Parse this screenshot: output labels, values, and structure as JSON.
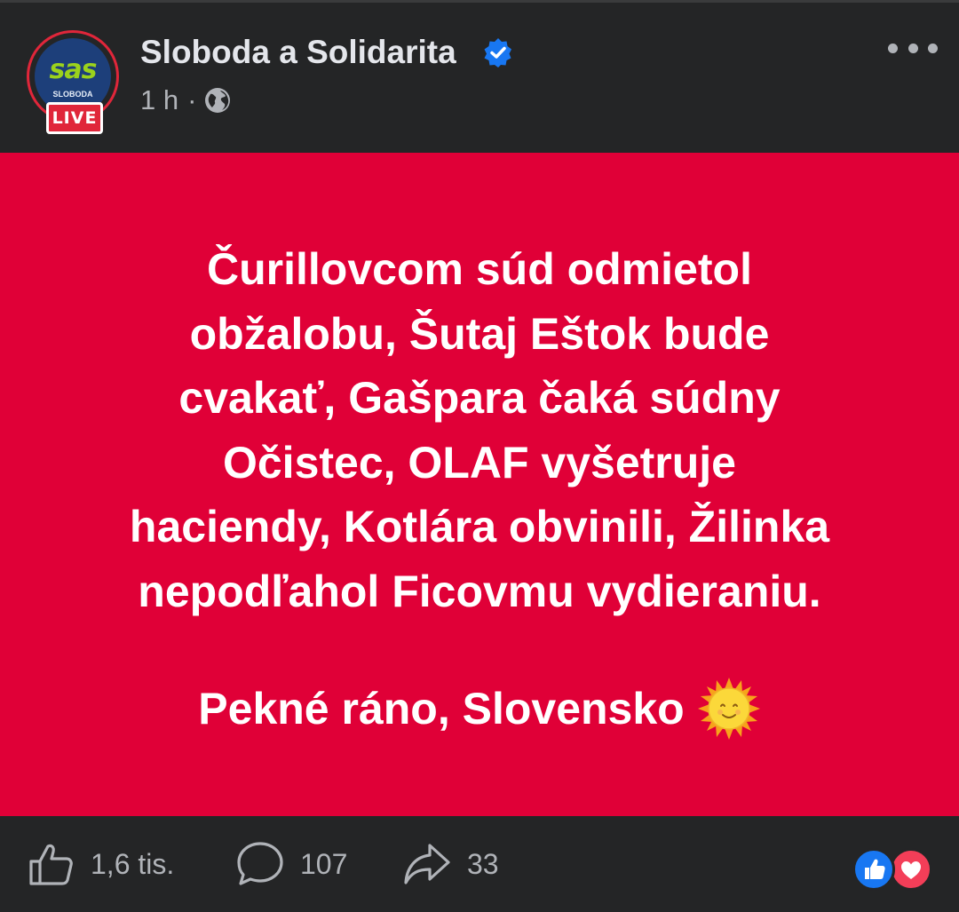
{
  "post": {
    "author": "Sloboda a Solidarita",
    "verified": true,
    "time": "1 h",
    "separator": "·",
    "audience_icon": "globe-icon",
    "avatar": {
      "logo_text": "sas",
      "logo_sub": "SLOBODA",
      "live_badge": "LIVE",
      "ring_color": "#e0263a",
      "logo_color": "#9bd21c"
    },
    "more_icon": "more-options-icon",
    "card": {
      "background": "#e00037",
      "headline_lines": [
        "Čurillovcom súd odmietol",
        "obžalobu, Šutaj Eštok bude",
        "cvakať, Gašpara čaká súdny",
        "Očistec, OLAF vyšetruje",
        "haciendy, Kotlára obvinili, Žilinka",
        "nepodľahol Ficovmu vydieraniu."
      ],
      "greeting": "Pekné ráno, Slovensko",
      "greeting_emoji": "sun-with-face"
    }
  },
  "footer": {
    "likes": "1,6 tis.",
    "comments": "107",
    "shares": "33",
    "reactions": [
      "like",
      "love"
    ]
  },
  "colors": {
    "header_bg": "#242526",
    "text_primary": "#e4e6eb",
    "text_secondary": "#b0b3b8",
    "verified_blue": "#1877f2"
  }
}
